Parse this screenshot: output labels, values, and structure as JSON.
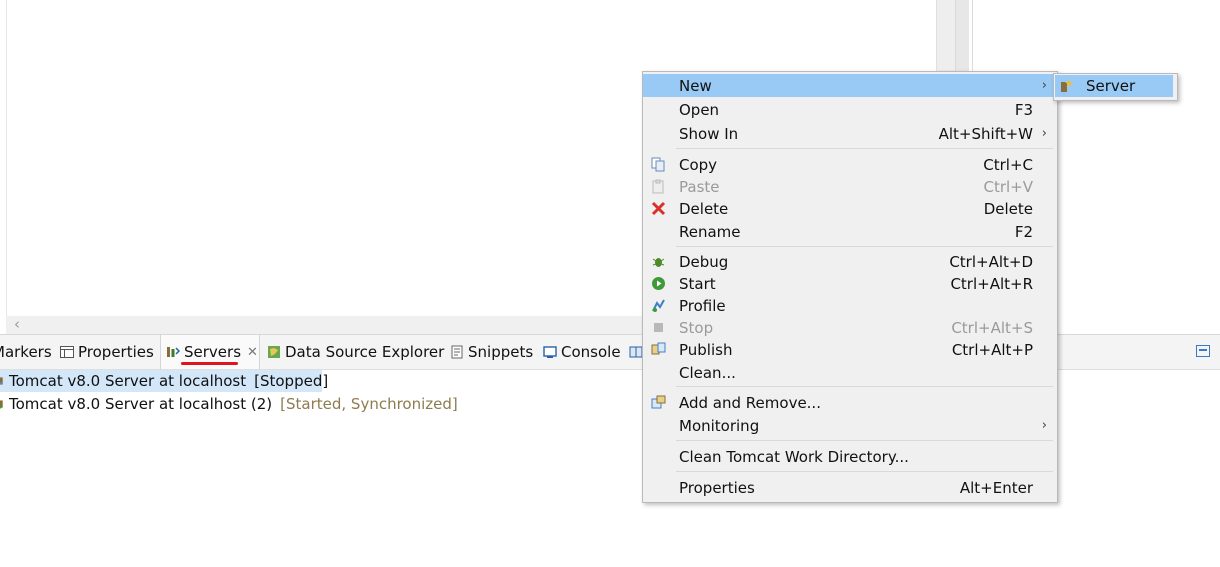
{
  "tabs": {
    "markers": "Markers",
    "properties": "Properties",
    "servers": "Servers",
    "data_source_explorer": "Data Source Explorer",
    "snippets": "Snippets",
    "console": "Console"
  },
  "servers_list": [
    {
      "name": "Tomcat v8.0 Server at localhost",
      "state": "[Stopped]"
    },
    {
      "name": "Tomcat v8.0 Server at localhost (2)",
      "state": "[Started, Synchronized]"
    }
  ],
  "context_menu": {
    "new": {
      "label": "New"
    },
    "open": {
      "label": "Open",
      "shortcut": "F3"
    },
    "show_in": {
      "label": "Show In",
      "shortcut": "Alt+Shift+W"
    },
    "copy": {
      "label": "Copy",
      "shortcut": "Ctrl+C"
    },
    "paste": {
      "label": "Paste",
      "shortcut": "Ctrl+V"
    },
    "delete": {
      "label": "Delete",
      "shortcut": "Delete"
    },
    "rename": {
      "label": "Rename",
      "shortcut": "F2"
    },
    "debug": {
      "label": "Debug",
      "shortcut": "Ctrl+Alt+D"
    },
    "start": {
      "label": "Start",
      "shortcut": "Ctrl+Alt+R"
    },
    "profile": {
      "label": "Profile",
      "shortcut": ""
    },
    "stop": {
      "label": "Stop",
      "shortcut": "Ctrl+Alt+S"
    },
    "publish": {
      "label": "Publish",
      "shortcut": "Ctrl+Alt+P"
    },
    "clean": {
      "label": "Clean..."
    },
    "add_remove": {
      "label": "Add and Remove..."
    },
    "monitoring": {
      "label": "Monitoring"
    },
    "clean_tomcat": {
      "label": "Clean Tomcat Work Directory..."
    },
    "properties": {
      "label": "Properties",
      "shortcut": "Alt+Enter"
    }
  },
  "submenu": {
    "server": "Server"
  },
  "colors": {
    "highlight": "#99c9f5",
    "selection": "#d3e7f9",
    "underline": "#e0141e",
    "muted_state": "#8e7b4f"
  }
}
